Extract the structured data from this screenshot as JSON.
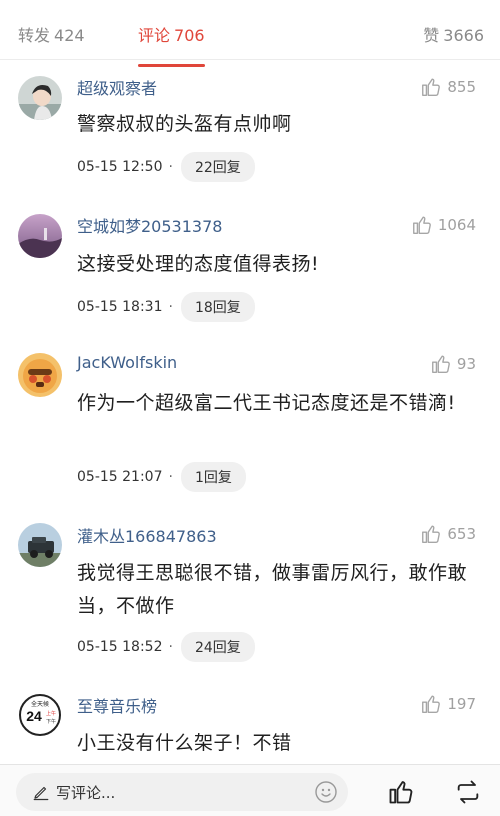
{
  "tabs": {
    "repost": {
      "label": "转发",
      "count": "424"
    },
    "comment": {
      "label": "评论",
      "count": "706"
    },
    "like": {
      "label": "赞",
      "count": "3666"
    }
  },
  "comments": [
    {
      "user": "超级观察者",
      "likes": "855",
      "text": "警察叔叔的头盔有点帅啊",
      "time": "05-15 12:50",
      "replies": "22回复",
      "avatar": "girl-portrait"
    },
    {
      "user": "空城如梦20531378",
      "likes": "1064",
      "text": "这接受处理的态度值得表扬!",
      "time": "05-15 18:31",
      "replies": "18回复",
      "avatar": "sunset-landscape"
    },
    {
      "user": "JacKWolfskin",
      "likes": "93",
      "text": "作为一个超级富二代王书记态度还是不错滴!",
      "time": "05-15 21:07",
      "replies": "1回复",
      "avatar": "cartoon-face"
    },
    {
      "user": "灌木丛166847863",
      "likes": "653",
      "text": "我觉得王思聪很不错，做事雷厉风行，敢作敢当，不做作",
      "time": "05-15 18:52",
      "replies": "24回复",
      "avatar": "jeep"
    },
    {
      "user": "至尊音乐榜",
      "likes": "197",
      "text": "小王没有什么架子！不错",
      "avatar": "24h-logo"
    }
  ],
  "avatar_logo_text": {
    "top": "全天候",
    "num": "24",
    "a": "上午",
    "b": "下午"
  },
  "bottom": {
    "placeholder": "写评论...",
    "icons": [
      "pen-icon",
      "emoji-icon",
      "thumb-up-icon",
      "repost-icon"
    ]
  },
  "colors": {
    "accent": "#e0463a",
    "username": "#3f5f8a"
  }
}
